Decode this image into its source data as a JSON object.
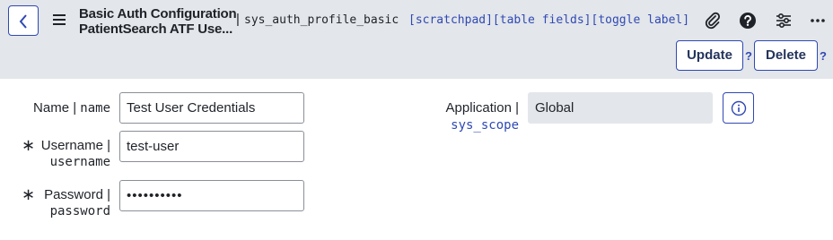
{
  "header": {
    "title_line1": "Basic Auth Configuration",
    "title_line2": "PatientSearch ATF Use...",
    "separator": "|",
    "table_name": "sys_auth_profile_basic",
    "links": {
      "scratchpad": "[scratchpad]",
      "table_fields": "[table fields]",
      "toggle_label": "[toggle label]"
    },
    "icons": [
      "back-icon",
      "menu-icon",
      "paperclip-icon",
      "help-icon",
      "settings-sliders-icon",
      "more-icon"
    ],
    "update_label": "Update",
    "delete_label": "Delete",
    "help_mark": "?"
  },
  "form": {
    "name": {
      "label": "Name |",
      "field": "name",
      "value": "Test User Credentials"
    },
    "username": {
      "required_mark": "∗",
      "label": "Username |",
      "field": "username",
      "value": "test-user"
    },
    "password": {
      "required_mark": "∗",
      "label": "Password |",
      "field": "password",
      "value": "••••••••••"
    },
    "application": {
      "label": "Application |",
      "field": "sys_scope",
      "value": "Global"
    }
  },
  "colors": {
    "accent": "#2f49b4",
    "header_bg": "#e3e6ea",
    "text": "#1f2329"
  }
}
